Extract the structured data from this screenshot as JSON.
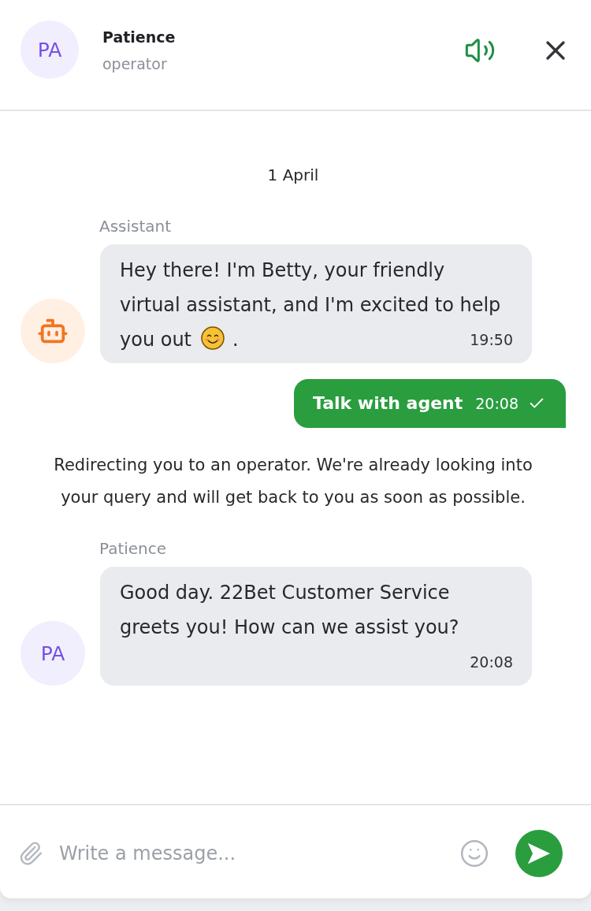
{
  "header": {
    "avatar_initials": "PA",
    "name": "Patience",
    "role": "operator",
    "sound_on": true
  },
  "messages": [
    {
      "kind": "date",
      "text": "1 April"
    },
    {
      "kind": "incoming",
      "sender": "Assistant",
      "avatar": {
        "kind": "bot"
      },
      "blocks": [
        [
          {
            "kind": "text",
            "text": "Hey there! I'm Betty, your friendly virtual assistant, and I'm excited to help"
          }
        ],
        [
          {
            "kind": "text",
            "text": "you out"
          },
          {
            "kind": "emoji"
          },
          {
            "kind": "text",
            "text": "."
          }
        ]
      ],
      "time": "19:50"
    },
    {
      "kind": "outgoing",
      "text": "Talk with agent",
      "time": "20:08",
      "delivered": true
    },
    {
      "kind": "system",
      "text": "Redirecting you to an operator. We're already looking into your query and will get back to you as soon as possible."
    },
    {
      "kind": "incoming",
      "sender": "Patience",
      "avatar": {
        "kind": "initials",
        "initials": "PA"
      },
      "blocks": [
        [
          {
            "kind": "text",
            "text": "Good day. 22Bet Customer Service greets you! How can we assist you?"
          }
        ]
      ],
      "time": "20:08"
    }
  ],
  "composer": {
    "placeholder": "Write a message..."
  }
}
